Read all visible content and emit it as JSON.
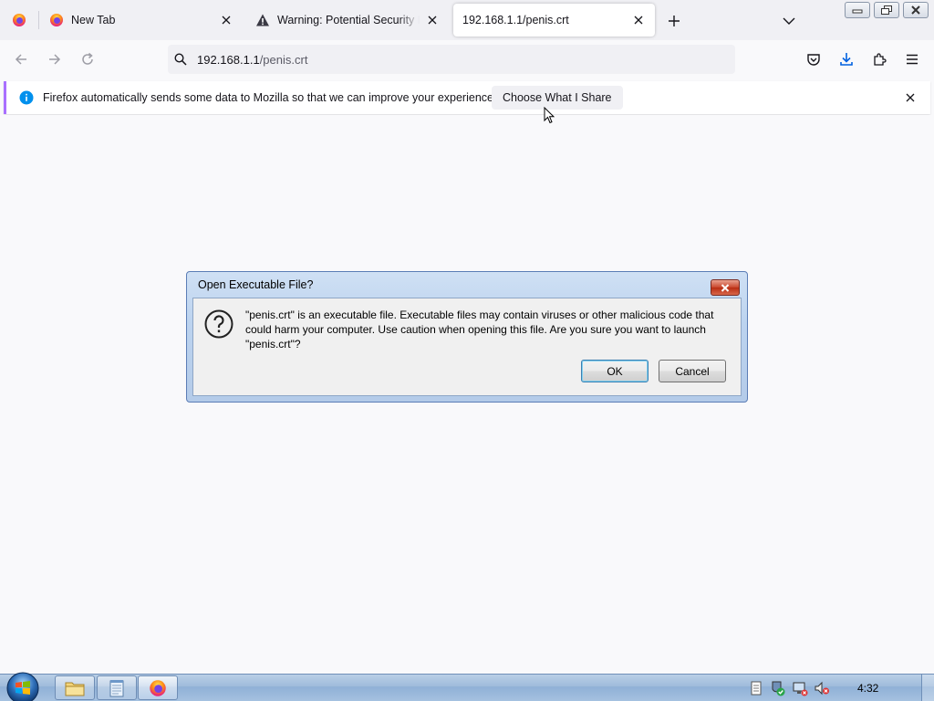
{
  "tabs": [
    {
      "title": "New Tab",
      "favicon": "firefox-icon"
    },
    {
      "title": "Warning: Potential Security Risk Ahead",
      "favicon": "warning-icon"
    },
    {
      "title": "192.168.1.1/penis.crt",
      "favicon": "none",
      "active": true
    }
  ],
  "toolbar": {
    "url_host": "192.168.1.1",
    "url_path": "/penis.crt",
    "icons": [
      "back-icon",
      "forward-icon",
      "reload-icon",
      "pocket-icon",
      "downloads-icon",
      "extensions-icon",
      "menu-icon"
    ]
  },
  "notification": {
    "message": "Firefox automatically sends some data to Mozilla so that we can improve your experience.",
    "button_label": "Choose What I Share"
  },
  "dialog": {
    "title": "Open Executable File?",
    "message": "\"penis.crt\" is an executable file. Executable files may contain viruses or other malicious code that could harm your computer. Use caution when opening this file. Are you sure you want to launch \"penis.crt\"?",
    "ok_label": "OK",
    "cancel_label": "Cancel"
  },
  "taskbar": {
    "clock": "4:32",
    "apps": [
      "explorer-icon",
      "notepad-icon",
      "firefox-icon"
    ]
  },
  "colors": {
    "accent": "#0061e0",
    "notification_border": "#a970ff",
    "dialog_frame": "#b4cbe9",
    "taskbar": "#9fbbdb"
  }
}
